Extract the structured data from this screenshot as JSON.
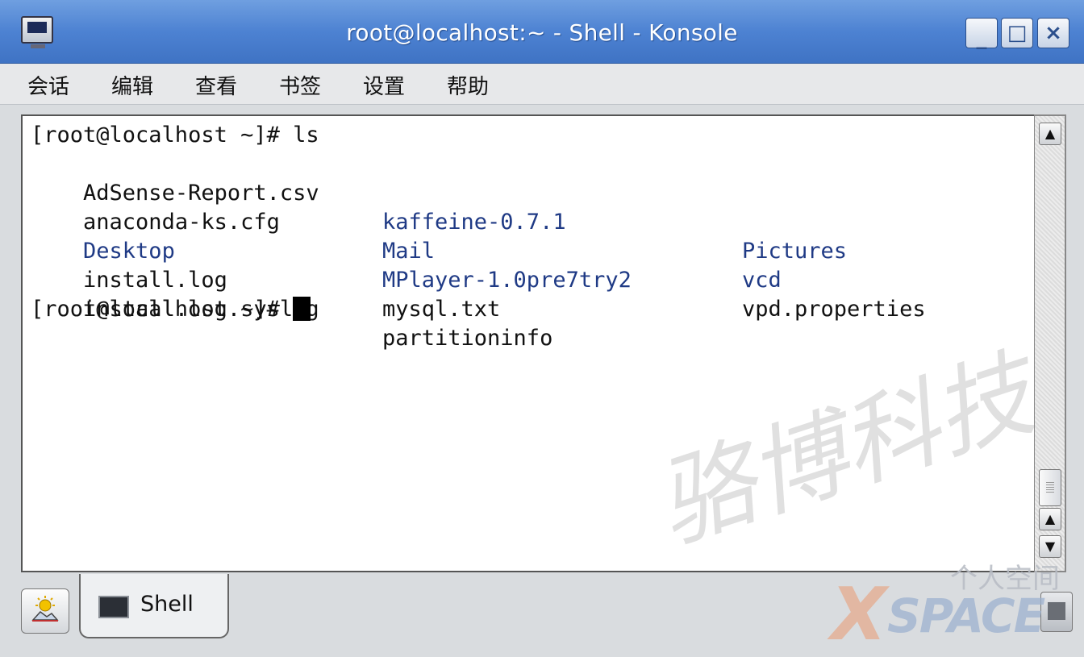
{
  "window": {
    "title": "root@localhost:~ - Shell - Konsole",
    "buttons": {
      "minimize": "_",
      "maximize": "□",
      "close": "×"
    }
  },
  "menu": [
    "会话",
    "编辑",
    "查看",
    "书签",
    "设置",
    "帮助"
  ],
  "terminal": {
    "prompt1": "[root@localhost ~]# ",
    "command": "ls",
    "rows": [
      [
        "AdSense-Report.csv",
        "kaffeine-0.7.1",
        "Pictures"
      ],
      [
        "anaconda-ks.cfg",
        "Mail",
        "vcd"
      ],
      [
        "Desktop",
        "MPlayer-1.0pre7try2",
        "vpd.properties"
      ],
      [
        "install.log",
        "mysql.txt",
        ""
      ],
      [
        "install.log.syslog",
        "partitioninfo",
        ""
      ]
    ],
    "prompt2": "[root@localhost ~]# ",
    "dir_color": "#1f3a85"
  },
  "watermark": "骆博科技",
  "tabs": [
    {
      "label": "Shell"
    }
  ],
  "logo": {
    "cn": "个人空间",
    "en": "SPACE",
    "x": "X"
  },
  "colors": {
    "titlebar": "#4d82d2",
    "directory": "#1f3a85"
  }
}
